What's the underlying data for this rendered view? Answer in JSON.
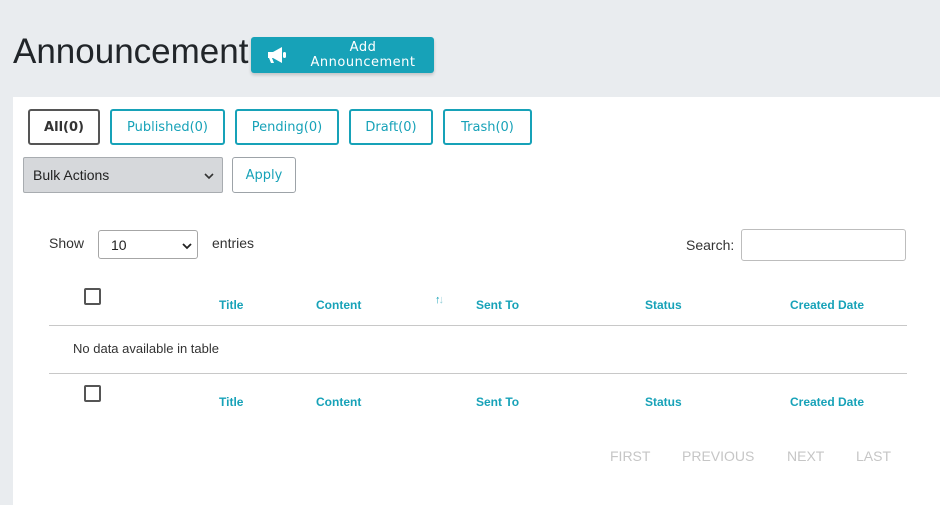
{
  "page": {
    "title": "Announcement",
    "add_button_label": "Add Announcement"
  },
  "tabs": [
    {
      "label": "All(0)",
      "active": true
    },
    {
      "label": "Published(0)",
      "active": false
    },
    {
      "label": "Pending(0)",
      "active": false
    },
    {
      "label": "Draft(0)",
      "active": false
    },
    {
      "label": "Trash(0)",
      "active": false
    }
  ],
  "bulk_actions": {
    "selected": "Bulk Actions",
    "apply_label": "Apply"
  },
  "table_controls": {
    "show_label": "Show",
    "entries_value": "10",
    "entries_label": "entries",
    "search_label": "Search:",
    "search_value": ""
  },
  "table": {
    "columns": [
      "Title",
      "Content",
      "Sent To",
      "Status",
      "Created Date"
    ],
    "sorted_column": "Content",
    "empty_message": "No data available in table"
  },
  "pagination": {
    "first": "FIRST",
    "previous": "PREVIOUS",
    "next": "NEXT",
    "last": "LAST"
  },
  "colors": {
    "accent": "#17a2b8",
    "background": "#e9ecef",
    "disabled_text": "#c6c6c6"
  },
  "icons": [
    "megaphone-icon",
    "chevron-down-icon",
    "sort-icon"
  ]
}
